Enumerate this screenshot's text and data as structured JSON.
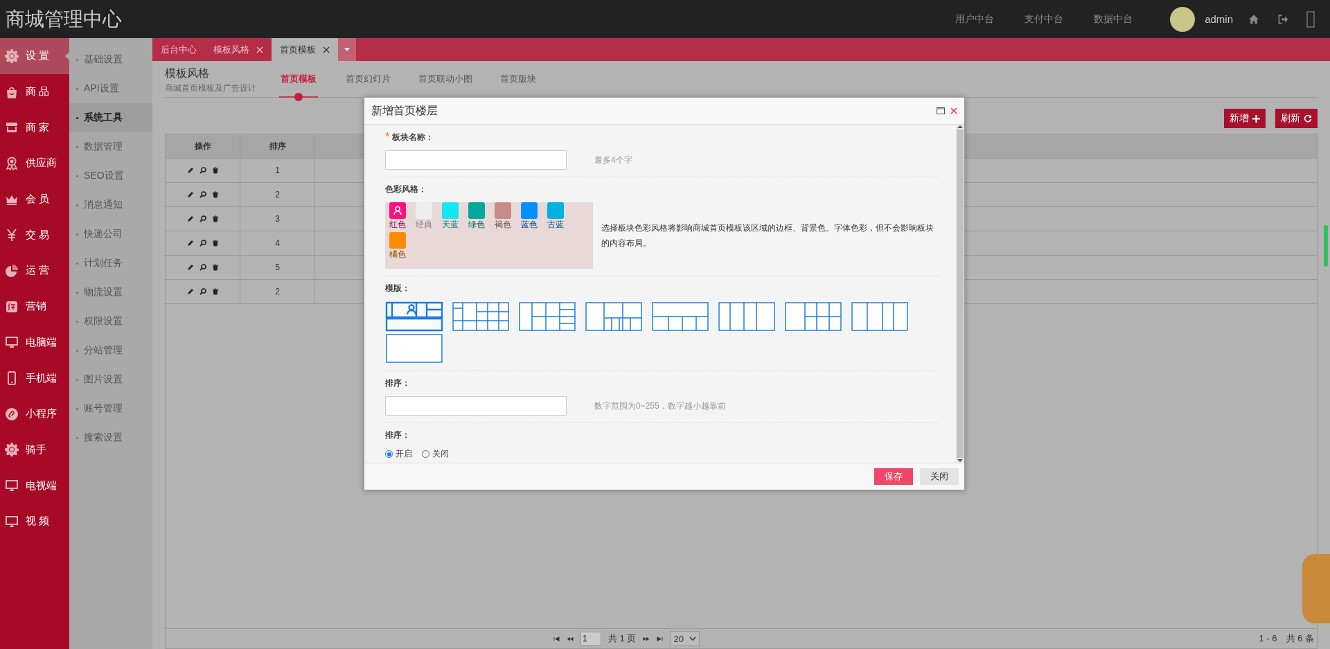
{
  "header": {
    "title": "商城管理中心",
    "links": [
      "用户中台",
      "支付中台",
      "数据中台"
    ],
    "user": "admin"
  },
  "main_nav": [
    {
      "label": "设 置",
      "selected": true
    },
    {
      "label": "商 品",
      "selected": false
    },
    {
      "label": "商 家",
      "selected": false
    },
    {
      "label": "供应商",
      "selected": false
    },
    {
      "label": "会 员",
      "selected": false
    },
    {
      "label": "交 易",
      "selected": false
    },
    {
      "label": "运 营",
      "selected": false
    },
    {
      "label": "营销",
      "selected": false
    },
    {
      "label": "电脑端",
      "selected": false
    },
    {
      "label": "手机端",
      "selected": false
    },
    {
      "label": "小程序",
      "selected": false
    },
    {
      "label": "骑手",
      "selected": false
    },
    {
      "label": "电视端",
      "selected": false
    },
    {
      "label": "视 频",
      "selected": false
    }
  ],
  "sub_nav": [
    {
      "label": "基础设置",
      "selected": false
    },
    {
      "label": "API设置",
      "selected": false
    },
    {
      "label": "系统工具",
      "selected": true
    },
    {
      "label": "数据管理",
      "selected": false
    },
    {
      "label": "SEO设置",
      "selected": false
    },
    {
      "label": "消息通知",
      "selected": false
    },
    {
      "label": "快递公司",
      "selected": false
    },
    {
      "label": "计划任务",
      "selected": false
    },
    {
      "label": "物流设置",
      "selected": false
    },
    {
      "label": "权限设置",
      "selected": false
    },
    {
      "label": "分站管理",
      "selected": false
    },
    {
      "label": "图片设置",
      "selected": false
    },
    {
      "label": "账号管理",
      "selected": false
    },
    {
      "label": "搜索设置",
      "selected": false
    }
  ],
  "page_tabs": [
    {
      "label": "后台中心",
      "closable": false,
      "selected": false
    },
    {
      "label": "模板风格",
      "closable": true,
      "selected": false
    },
    {
      "label": "首页模板",
      "closable": true,
      "selected": true
    }
  ],
  "page_header": {
    "title": "模板风格",
    "subtitle": "商城首页模板及广告设计"
  },
  "section_tabs": [
    {
      "label": "首页模板",
      "selected": true
    },
    {
      "label": "首页幻灯片",
      "selected": false
    },
    {
      "label": "首页联动小图",
      "selected": false
    },
    {
      "label": "首页版块",
      "selected": false
    }
  ],
  "toolbar": {
    "add": "新增",
    "refresh": "刷新"
  },
  "table": {
    "columns": [
      "操作",
      "排序"
    ],
    "rows": [
      [
        "1"
      ],
      [
        "2"
      ],
      [
        "3"
      ],
      [
        "4"
      ],
      [
        "5"
      ],
      [
        "2"
      ]
    ]
  },
  "pagination": {
    "page": "1",
    "total_pages": "共 1 页",
    "page_size": "20",
    "summary": "1 - 6　共 6 条"
  },
  "dialog": {
    "title": "新增首页楼层",
    "name_field": {
      "label": "板块名称：",
      "required_mark": "*",
      "hint": "最多4个字"
    },
    "color_field": {
      "label": "色彩风格：",
      "description": "选择板块色彩风格将影响商城首页模板该区域的边框、背景色、字体色彩，但不会影响板块的内容布局。",
      "options": [
        {
          "name": "红色",
          "color": "#ff0f7b",
          "selected": true
        },
        {
          "name": "经典",
          "color": "#eeeeee",
          "selected": false
        },
        {
          "name": "天蓝",
          "color": "#14e6f2",
          "selected": false
        },
        {
          "name": "绿色",
          "color": "#00a99d",
          "selected": false
        },
        {
          "name": "褐色",
          "color": "#c98a8a",
          "selected": false
        },
        {
          "name": "蓝色",
          "color": "#0090ff",
          "selected": false
        },
        {
          "name": "古蓝",
          "color": "#00b2e0",
          "selected": false
        },
        {
          "name": "橘色",
          "color": "#ff8c00",
          "selected": false
        }
      ]
    },
    "template_field": {
      "label": "模版：",
      "templates": [
        {
          "selected": true
        },
        {
          "selected": false
        },
        {
          "selected": false
        },
        {
          "selected": false
        },
        {
          "selected": false
        },
        {
          "selected": false
        },
        {
          "selected": false
        },
        {
          "selected": false
        },
        {
          "selected": false
        }
      ]
    },
    "sort_field": {
      "label": "排序：",
      "hint": "数字范围为0~255，数字越小越靠前"
    },
    "status_field": {
      "label": "排序：",
      "options": [
        {
          "label": "开启",
          "selected": true
        },
        {
          "label": "关闭",
          "selected": false
        }
      ]
    },
    "buttons": {
      "save": "保存",
      "close": "关闭"
    }
  }
}
